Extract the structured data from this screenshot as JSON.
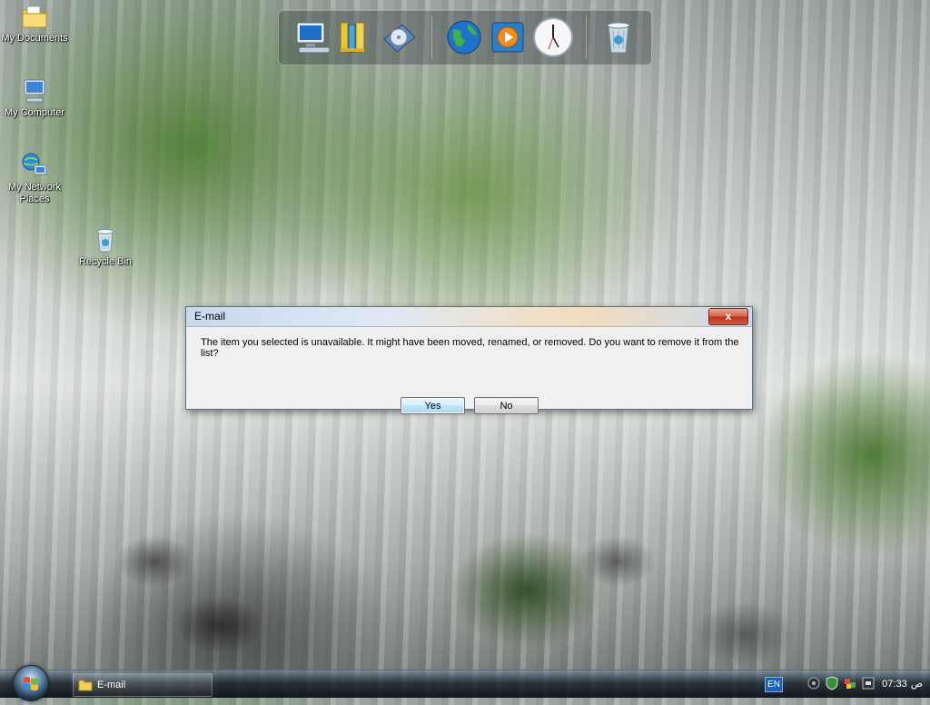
{
  "desktop": {
    "icons": [
      {
        "label": "My Documents",
        "icon": "folder-documents-icon"
      },
      {
        "label": "My Computer",
        "icon": "computer-icon"
      },
      {
        "label": "My Network Places",
        "icon": "network-places-icon"
      },
      {
        "label": "Recycle Bin",
        "icon": "recycle-bin-icon"
      }
    ]
  },
  "dock": {
    "items": [
      {
        "name": "computer-monitor-icon"
      },
      {
        "name": "books-icon"
      },
      {
        "name": "disc-drive-icon"
      },
      {
        "name": "globe-icon"
      },
      {
        "name": "media-player-icon"
      },
      {
        "name": "clock-icon"
      },
      {
        "name": "trash-icon"
      }
    ]
  },
  "dialog": {
    "title": "E-mail",
    "close_label": "x",
    "message": "The item you selected is unavailable.  It might have been moved, renamed, or removed.  Do you want to remove it from the list?",
    "yes_label": "Yes",
    "no_label": "No"
  },
  "taskbar": {
    "task_label": "E-mail",
    "language": "EN",
    "time": "07:33",
    "ampm": "ص"
  },
  "colors": {
    "dialog_bg": "#f0f0f0",
    "close_button": "#c8442b",
    "default_button_border": "#3c7fb1"
  }
}
